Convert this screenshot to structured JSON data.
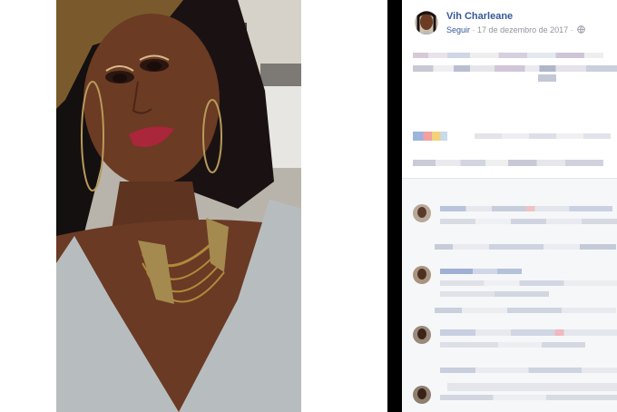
{
  "post": {
    "author_name": "Vih Charleane",
    "follow_label": "Seguir",
    "separator": "·",
    "timestamp": "17 de dezembro de 2017",
    "privacy_icon": "globe-icon"
  },
  "colors": {
    "link_blue": "#365899",
    "meta_gray": "#90949c",
    "comments_bg": "#f6f7f9"
  }
}
